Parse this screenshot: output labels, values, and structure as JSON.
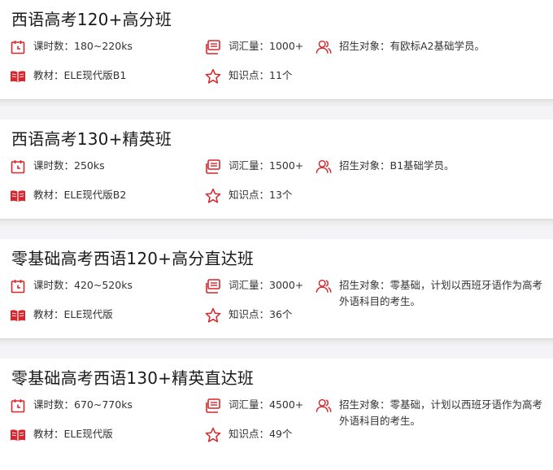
{
  "theme": {
    "accent": "#d9252b",
    "text": "#333333",
    "title": "#1a1a1a",
    "divider": "#f4f4f6"
  },
  "courses": [
    {
      "title": "西语高考120+高分班",
      "hours": "课时数：180~220ks",
      "vocab": "词汇量：1000+",
      "target": "招生对象：有欧标A2基础学员。",
      "textbook": "教材：ELE现代版B1",
      "points": "知识点：11个"
    },
    {
      "title": "西语高考130+精英班",
      "hours": "课时数：250ks",
      "vocab": "词汇量：1500+",
      "target": "招生对象：B1基础学员。",
      "textbook": "教材：ELE现代版B2",
      "points": "知识点：13个"
    },
    {
      "title": "零基础高考西语120+高分直达班",
      "hours": "课时数：420~520ks",
      "vocab": "词汇量：3000+",
      "target": "招生对象：零基础，计划以西班牙语作为高考外语科目的考生。",
      "textbook": "教材：ELE现代版",
      "points": "知识点：36个"
    },
    {
      "title": "零基础高考西语130+精英直达班",
      "hours": "课时数：670~770ks",
      "vocab": "词汇量：4500+",
      "target": "招生对象：零基础，计划以西班牙语作为高考外语科目的考生。",
      "textbook": "教材：ELE现代版",
      "points": "知识点：49个"
    }
  ]
}
